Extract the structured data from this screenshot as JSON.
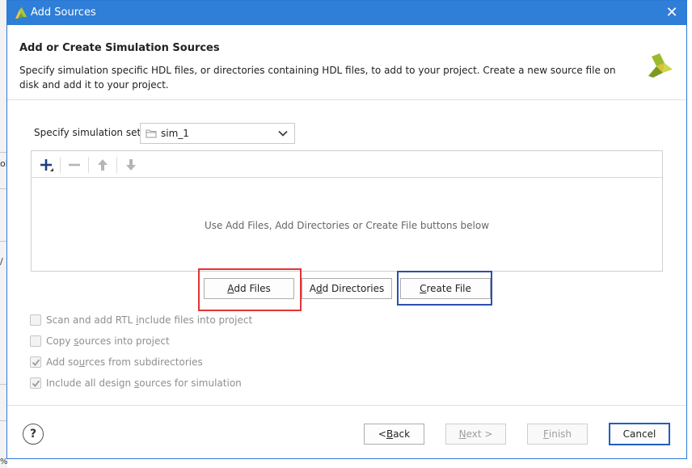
{
  "window": {
    "title": "Add Sources",
    "close_glyph": "✕"
  },
  "header": {
    "title": "Add or Create Simulation Sources",
    "description": "Specify simulation specific HDL files, or directories containing HDL files, to add to your project. Create a new source file on disk and add it to your project."
  },
  "simulation_set": {
    "label": "Specify simulation set:",
    "value": "sim_1"
  },
  "files_panel": {
    "empty_message": "Use Add Files, Add Directories or Create File buttons below",
    "toolbar_icons": [
      "add-icon",
      "remove-icon",
      "move-up-icon",
      "move-down-icon"
    ]
  },
  "action_buttons": {
    "add_files": {
      "pre": "",
      "mnemonic": "A",
      "post": "dd Files"
    },
    "add_directories": {
      "pre": "A",
      "mnemonic": "d",
      "post": "d Directories"
    },
    "create_file": {
      "pre": "",
      "mnemonic": "C",
      "post": "reate File"
    }
  },
  "options": [
    {
      "pre": "Scan and add RTL ",
      "mnemonic": "i",
      "post": "nclude files into project",
      "checked": false
    },
    {
      "pre": "Copy ",
      "mnemonic": "s",
      "post": "ources into project",
      "checked": false
    },
    {
      "pre": "Add so",
      "mnemonic": "u",
      "post": "rces from subdirectories",
      "checked": true
    },
    {
      "pre": "Include all design ",
      "mnemonic": "s",
      "post": "ources for simulation",
      "checked": true
    }
  ],
  "footer": {
    "help": "?",
    "back": {
      "pre": "< ",
      "mnemonic": "B",
      "post": "ack"
    },
    "next": {
      "pre": "",
      "mnemonic": "N",
      "post": "ext >"
    },
    "finish": {
      "pre": "",
      "mnemonic": "F",
      "post": "inish"
    },
    "cancel": "Cancel"
  },
  "background_window": {
    "fragment_1": "oi",
    "fragment_2": "/",
    "fragment_3": "%"
  },
  "colors": {
    "titlebar": "#2f7ed8",
    "highlight_red": "#e43333",
    "highlight_blue": "#2d4fae"
  }
}
